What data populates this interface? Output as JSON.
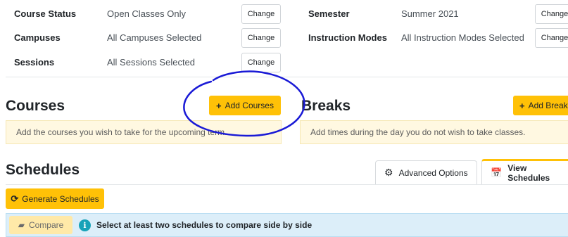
{
  "filters": {
    "course_status": {
      "label": "Course Status",
      "value": "Open Classes Only",
      "button": "Change"
    },
    "campuses": {
      "label": "Campuses",
      "value": "All Campuses Selected",
      "button": "Change"
    },
    "sessions": {
      "label": "Sessions",
      "value": "All Sessions Selected",
      "button": "Change"
    },
    "semester": {
      "label": "Semester",
      "value": "Summer 2021",
      "button": "Change"
    },
    "instruction_modes": {
      "label": "Instruction Modes",
      "value": "All Instruction Modes Selected",
      "button": "Change"
    }
  },
  "courses": {
    "title": "Courses",
    "add_button": "Add Courses",
    "hint": "Add the courses you wish to take for the upcoming term."
  },
  "breaks": {
    "title": "Breaks",
    "add_button": "Add Breaks",
    "hint": "Add times during the day you do not wish to take classes."
  },
  "schedules": {
    "title": "Schedules",
    "tab_advanced": "Advanced Options",
    "tab_view": "View Schedules",
    "generate_button": "Generate Schedules",
    "compare_button": "Compare",
    "info_text": "Select at least two schedules to compare side by side"
  },
  "colors": {
    "accent": "#ffc107",
    "annotation": "#1a1ad6",
    "info": "#17a2b8"
  }
}
